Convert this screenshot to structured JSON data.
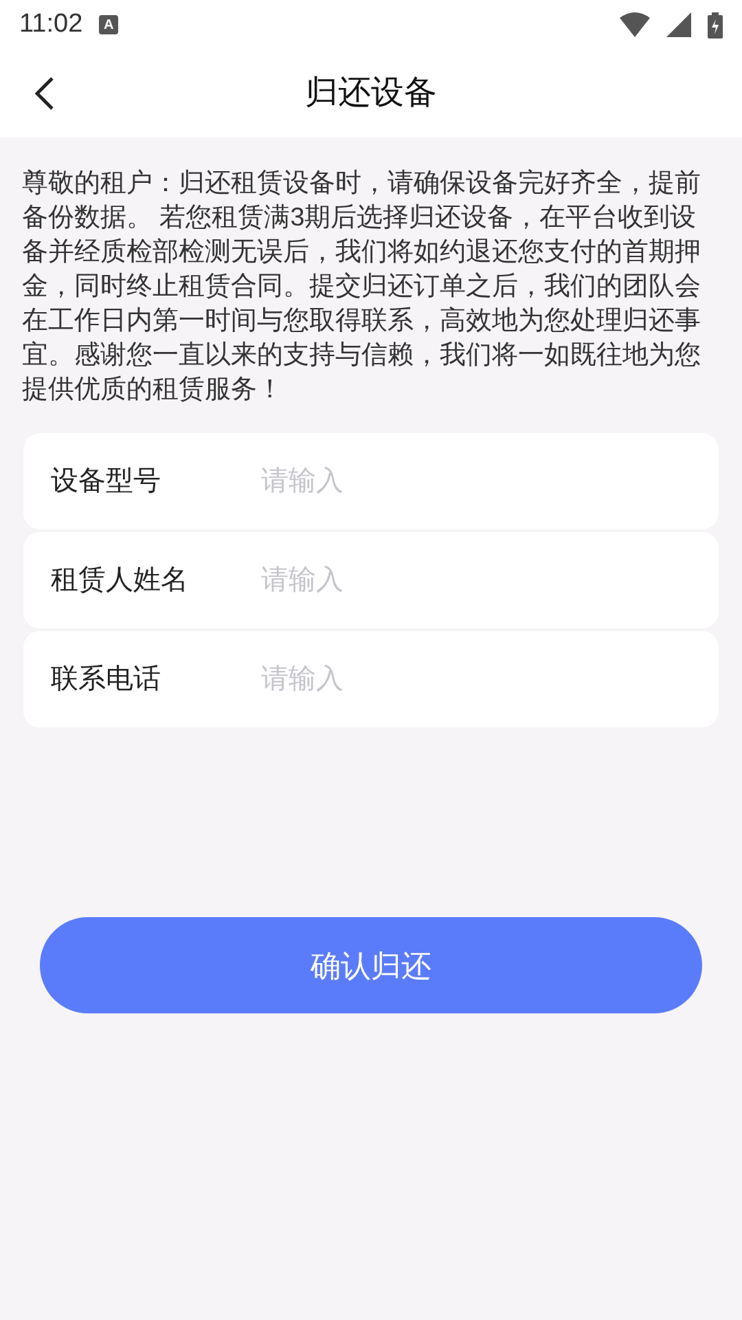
{
  "status_bar": {
    "time": "11:02",
    "notification": "A"
  },
  "header": {
    "title": "归还设备"
  },
  "notice": "尊敬的租户：归还租赁设备时，请确保设备完好齐全，提前备份数据。 若您租赁满3期后选择归还设备，在平台收到设备并经质检部检测无误后，我们将如约退还您支付的首期押金，同时终止租赁合同。提交归还订单之后，我们的团队会在工作日内第一时间与您取得联系，高效地为您处理归还事宜。感谢您一直以来的支持与信赖，我们将一如既往地为您提供优质的租赁服务！",
  "form": [
    {
      "label": "设备型号",
      "placeholder": "请输入"
    },
    {
      "label": "租赁人姓名",
      "placeholder": "请输入"
    },
    {
      "label": "联系电话",
      "placeholder": "请输入"
    }
  ],
  "submit": "确认归还"
}
